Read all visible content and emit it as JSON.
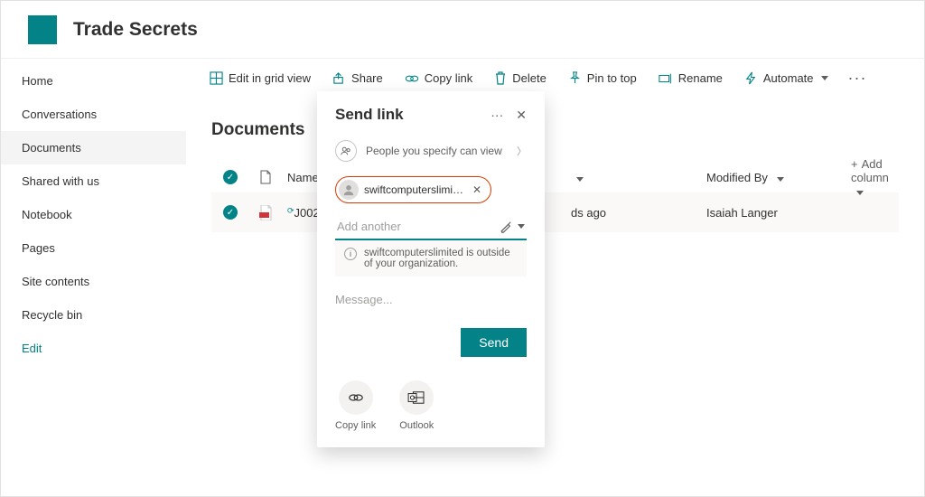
{
  "site": {
    "title": "Trade Secrets"
  },
  "sidenav": {
    "items": [
      {
        "label": "Home"
      },
      {
        "label": "Conversations"
      },
      {
        "label": "Documents"
      },
      {
        "label": "Shared with us"
      },
      {
        "label": "Notebook"
      },
      {
        "label": "Pages"
      },
      {
        "label": "Site contents"
      },
      {
        "label": "Recycle bin"
      }
    ],
    "edit": "Edit"
  },
  "commands": {
    "gridview": "Edit in grid view",
    "share": "Share",
    "copylink": "Copy link",
    "delete": "Delete",
    "pin": "Pin to top",
    "rename": "Rename",
    "automate": "Automate"
  },
  "library": {
    "title": "Documents",
    "columns": {
      "name": "Name",
      "modifiedBy": "Modified By",
      "addColumn": "Add column"
    },
    "rows": [
      {
        "file": "J00231",
        "modified": "ds ago",
        "modifiedBy": "Isaiah Langer"
      }
    ]
  },
  "dialog": {
    "title": "Send link",
    "permission": "People you specify can view",
    "recipient": "swiftcomputerslimi…",
    "addPlaceholder": "Add another",
    "warning": "swiftcomputerslimited is outside of your organization.",
    "messagePlaceholder": "Message...",
    "sendLabel": "Send",
    "actions": {
      "copyLink": "Copy link",
      "outlook": "Outlook"
    }
  }
}
